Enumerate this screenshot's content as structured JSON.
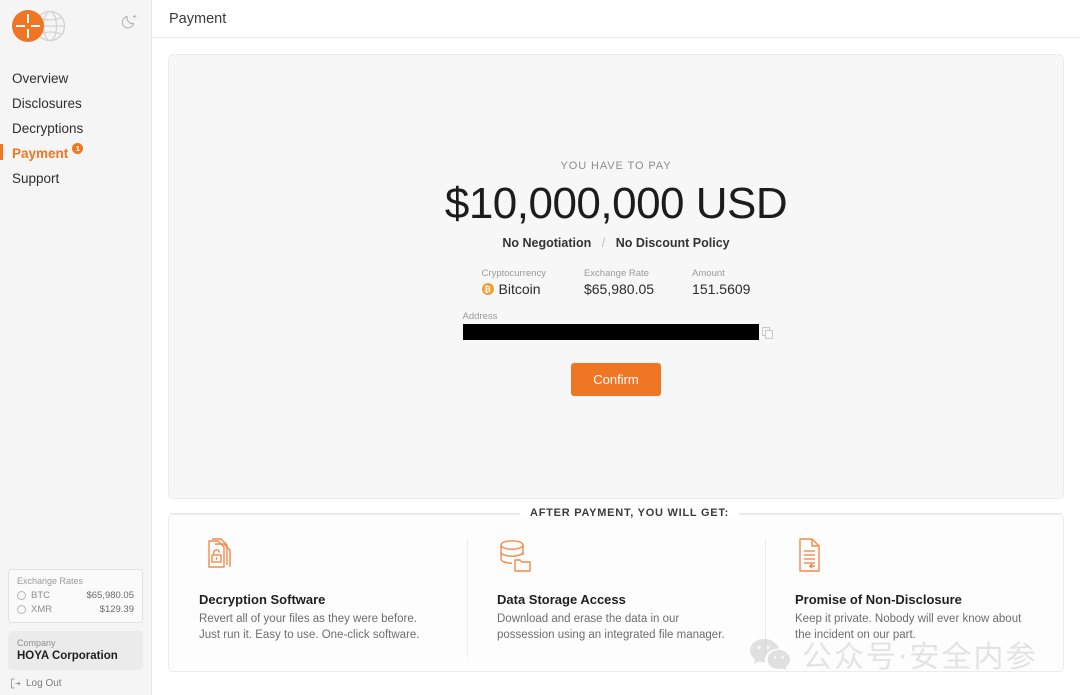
{
  "sidebar": {
    "logo_icon": "globe-crosshair-logo",
    "theme_toggle_icon": "moon-icon",
    "nav": [
      {
        "label": "Overview",
        "active": false,
        "badge": ""
      },
      {
        "label": "Disclosures",
        "active": false,
        "badge": ""
      },
      {
        "label": "Decryptions",
        "active": false,
        "badge": ""
      },
      {
        "label": "Payment",
        "active": true,
        "badge": "1"
      },
      {
        "label": "Support",
        "active": false,
        "badge": ""
      }
    ],
    "rates": {
      "title": "Exchange Rates",
      "rows": [
        {
          "icon": "btc-icon",
          "name": "BTC",
          "value": "$65,980.05"
        },
        {
          "icon": "xmr-icon",
          "name": "XMR",
          "value": "$129.39"
        }
      ]
    },
    "company": {
      "label": "Company",
      "name": "HOYA Corporation"
    },
    "logout": {
      "label": "Log Out",
      "icon": "logout-icon"
    }
  },
  "header": {
    "title": "Payment"
  },
  "payment": {
    "eyebrow": "YOU HAVE TO PAY",
    "amount": "$10,000,000 USD",
    "term_left": "No Negotiation",
    "term_sep": "/",
    "term_right": "No Discount Policy",
    "fields": [
      {
        "label": "Cryptocurrency",
        "value": "Bitcoin",
        "icon": "bitcoin-icon"
      },
      {
        "label": "Exchange Rate",
        "value": "$65,980.05",
        "icon": ""
      },
      {
        "label": "Amount",
        "value": "151.5609",
        "icon": ""
      }
    ],
    "address_label": "Address",
    "address_value": "",
    "copy_icon": "copy-icon",
    "confirm_label": "Confirm"
  },
  "after_payment": {
    "heading": "AFTER PAYMENT, YOU WILL GET:",
    "benefits": [
      {
        "icon": "unlocked-files-icon",
        "title": "Decryption Software",
        "desc": "Revert all of your files as they were before. Just run it. Easy to use. One-click software."
      },
      {
        "icon": "database-folder-icon",
        "title": "Data Storage Access",
        "desc": "Download and erase the data in our possession using an integrated file manager."
      },
      {
        "icon": "document-icon",
        "title": "Promise of Non-Disclosure",
        "desc": "Keep it private. Nobody will ever know about the incident on our part."
      }
    ]
  },
  "watermark": {
    "text": "公众号·安全内参",
    "icon": "wechat-icon"
  },
  "colors": {
    "accent": "#ef7622",
    "bitcoin": "#f0a030",
    "card_bg": "#f7f7f7",
    "sidebar_bg": "#f5f5f5"
  }
}
